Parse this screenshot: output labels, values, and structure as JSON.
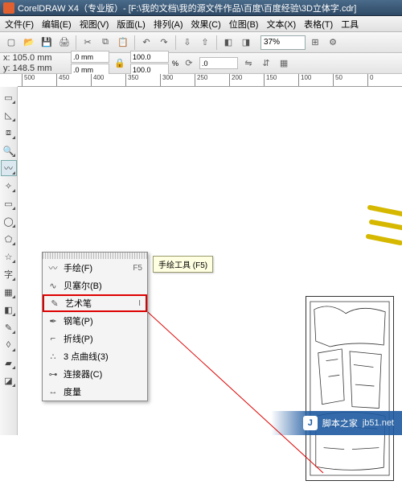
{
  "title": "CorelDRAW X4（专业版）- [F:\\我的文档\\我的源文件作品\\百度\\百度经验\\3D立体字.cdr]",
  "menu": {
    "file": "文件(F)",
    "edit": "编辑(E)",
    "view": "视图(V)",
    "layout": "版面(L)",
    "arrange": "排列(A)",
    "effects": "效果(C)",
    "bitmaps": "位图(B)",
    "text": "文本(X)",
    "table": "表格(T)",
    "tools": "工具"
  },
  "zoom": "37%",
  "pos": {
    "x": "x: 105.0 mm",
    "y": "y: 148.5 mm"
  },
  "dims": {
    "w": ".0 mm",
    "h": ".0 mm",
    "p1": "100.0",
    "p2": "100.0",
    "ang": ".0"
  },
  "ruler": [
    "500",
    "450",
    "400",
    "350",
    "300",
    "250",
    "200",
    "150",
    "100",
    "50",
    "0"
  ],
  "flyout": {
    "items": [
      {
        "icon": "〰",
        "label": "手绘(F)",
        "sc": "F5"
      },
      {
        "icon": "∿",
        "label": "贝塞尔(B)",
        "sc": ""
      },
      {
        "icon": "✎",
        "label": "艺术笔",
        "sc": "I",
        "hl": true
      },
      {
        "icon": "✒",
        "label": "钢笔(P)",
        "sc": ""
      },
      {
        "icon": "⌐",
        "label": "折线(P)",
        "sc": ""
      },
      {
        "icon": "∴",
        "label": "3 点曲线(3)",
        "sc": ""
      },
      {
        "icon": "⊶",
        "label": "连接器(C)",
        "sc": ""
      },
      {
        "icon": "↔",
        "label": "度量",
        "sc": ""
      }
    ]
  },
  "tooltip": "手绘工具 (F5)",
  "watermark": {
    "site": "脚本之家",
    "url": "jb51.net"
  }
}
